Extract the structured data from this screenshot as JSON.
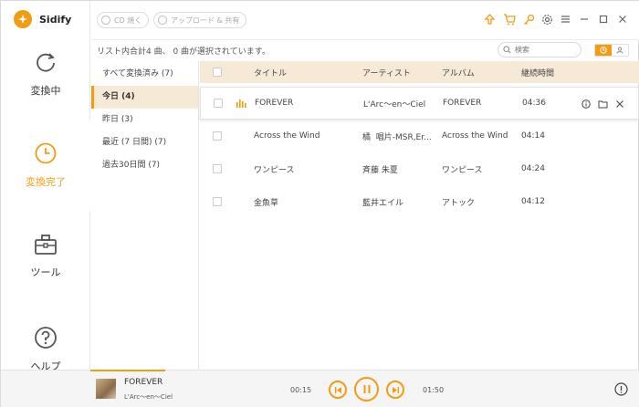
{
  "app": {
    "name": "Sidify"
  },
  "sidebar": {
    "items": [
      {
        "label": "変換中",
        "icon": "refresh-icon"
      },
      {
        "label": "変換完了",
        "icon": "clock-icon",
        "active": true
      },
      {
        "label": "ツール",
        "icon": "toolbox-icon"
      },
      {
        "label": "ヘルプ",
        "icon": "help-icon"
      }
    ]
  },
  "toolbar": {
    "burn_cd_label": "CD 焼く",
    "upload_share_label": "アップロード & 共有",
    "icons": [
      "upload-icon",
      "cart-icon",
      "key-icon",
      "gear-icon",
      "menu-icon",
      "minimize-icon",
      "maximize-icon",
      "close-icon"
    ]
  },
  "summary": "リスト内合計4 曲、 0 曲が選択されています。",
  "search": {
    "placeholder": "検索"
  },
  "categories": [
    {
      "label": "すべて変換済み (7)"
    },
    {
      "label": "今日 (4)",
      "active": true
    },
    {
      "label": "昨日 (3)"
    },
    {
      "label": "最近 (7 日間) (7)"
    },
    {
      "label": "過去30日間 (7)"
    }
  ],
  "table": {
    "headers": {
      "title": "タイトル",
      "artist": "アーティスト",
      "album": "アルバム",
      "duration": "継続時間"
    },
    "rows": [
      {
        "title": "FOREVER",
        "artist": "L'Arc～en～Ciel",
        "album": "FOREVER",
        "duration": "04:36",
        "playing": true
      },
      {
        "title": "Across the Wind",
        "artist": "橘 ️ 唱片-MSR,Er...",
        "album": "Across the Wind",
        "duration": "04:14"
      },
      {
        "title": "ワンピース",
        "artist": "斉藤 朱夏",
        "album": "ワンピース",
        "duration": "04:24"
      },
      {
        "title": "金魚草",
        "artist": "藍井エイル",
        "album": "アトック",
        "duration": "04:12"
      }
    ]
  },
  "player": {
    "title": "FOREVER",
    "artist": "L'Arc～en～Ciel",
    "elapsed": "00:15",
    "total": "01:50",
    "progress_fraction": 0.136
  },
  "colors": {
    "accent": "#f39c12",
    "header_bg": "#f6ead7"
  }
}
